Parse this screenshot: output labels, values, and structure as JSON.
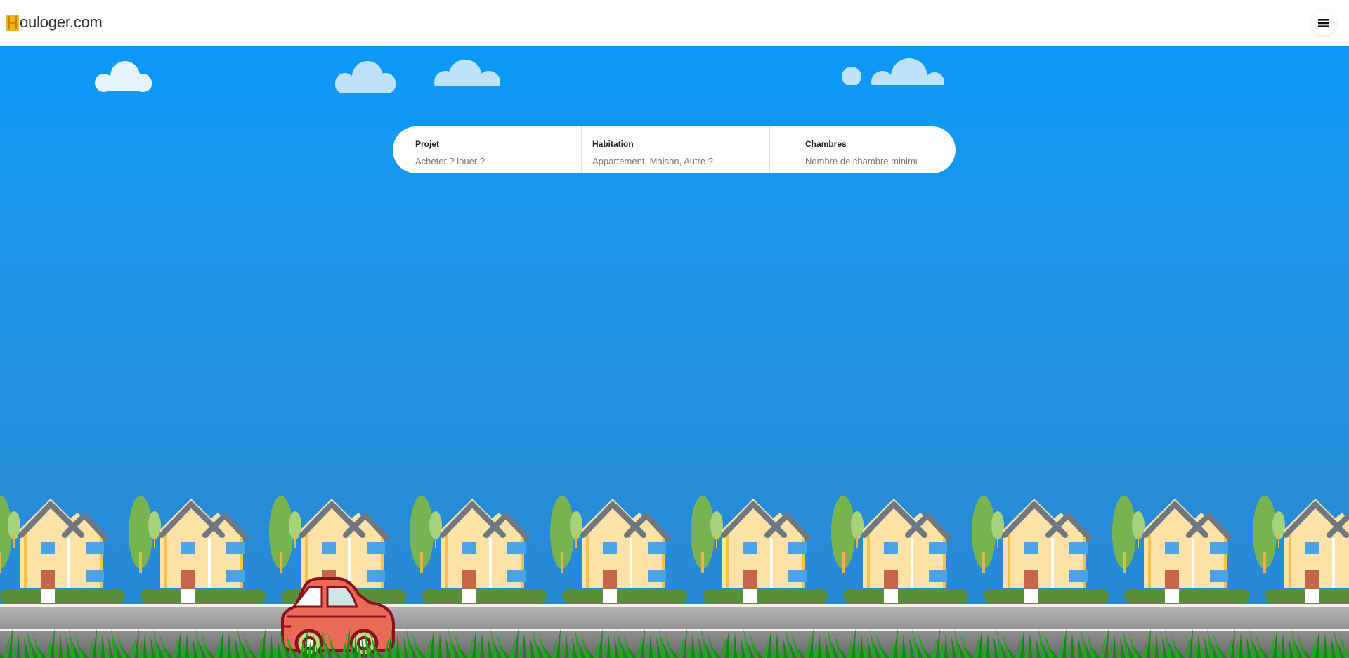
{
  "header": {
    "brand": "ouloger.com",
    "logo_letter": "H",
    "menu_icon": "hamburger-menu-icon"
  },
  "search": {
    "fields": [
      {
        "label": "Projet",
        "placeholder": "Acheter ? louer ?"
      },
      {
        "label": "Habitation",
        "placeholder": "Appartement, Maison, Autre ?"
      },
      {
        "label": "Chambres",
        "placeholder": "Nombre de chambre minimum"
      }
    ]
  },
  "colors": {
    "sky_top": "#0b98f8",
    "sky_bottom": "#2a87d2",
    "logo_accent": "#f2b41c",
    "house_wall": "#fde2a8",
    "house_roof": "#6f7780",
    "tree": "#78b352",
    "car": "#ea6a58",
    "road": "#8c8c8c",
    "grass": "#1a9b1a"
  },
  "illustration": {
    "icons": [
      "cloud-icon",
      "house-icon",
      "tree-icon",
      "car-icon",
      "grass-icon"
    ]
  }
}
